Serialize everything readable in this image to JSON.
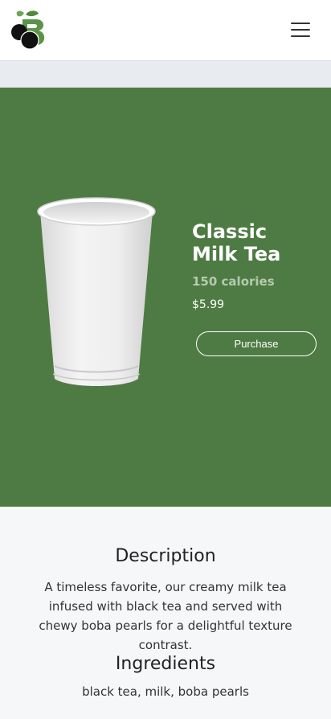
{
  "navbar": {
    "logo_icon": "boba-logo-icon",
    "menu_icon": "hamburger-menu-icon"
  },
  "product": {
    "image_icon": "paper-cup-image",
    "title": "Classic Milk Tea",
    "calories": "150 calories",
    "price": "$5.99",
    "purchase_label": "Purchase"
  },
  "details": {
    "description_heading": "Description",
    "description_text": "A timeless favorite, our creamy milk tea infused with black tea and served with chewy boba pearls for a delightful texture contrast.",
    "ingredients_heading": "Ingredients",
    "ingredients_text": "black tea, milk, boba pearls"
  },
  "colors": {
    "hero_bg": "#4e7b43",
    "nav_bg": "#ffffff",
    "page_bg": "#f6f7f9"
  }
}
